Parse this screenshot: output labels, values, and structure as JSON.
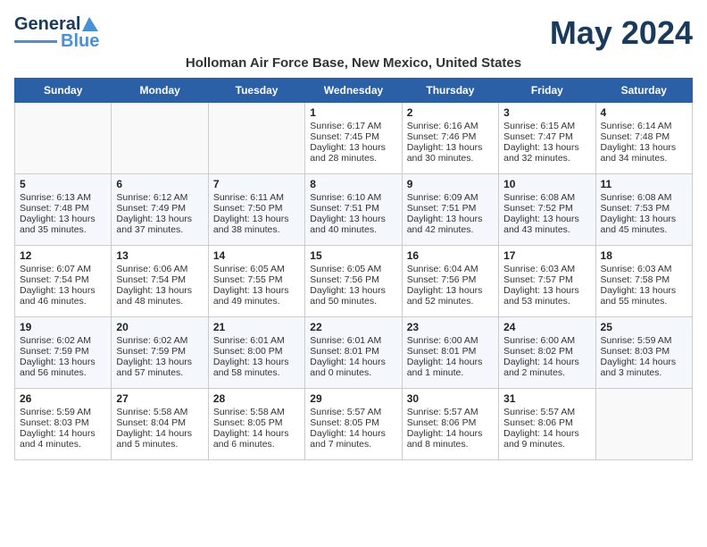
{
  "logo": {
    "line1": "General",
    "line2": "Blue"
  },
  "title": "May 2024",
  "subtitle": "Holloman Air Force Base, New Mexico, United States",
  "days_of_week": [
    "Sunday",
    "Monday",
    "Tuesday",
    "Wednesday",
    "Thursday",
    "Friday",
    "Saturday"
  ],
  "weeks": [
    [
      {
        "day": "",
        "sunrise": "",
        "sunset": "",
        "daylight": ""
      },
      {
        "day": "",
        "sunrise": "",
        "sunset": "",
        "daylight": ""
      },
      {
        "day": "",
        "sunrise": "",
        "sunset": "",
        "daylight": ""
      },
      {
        "day": "1",
        "sunrise": "Sunrise: 6:17 AM",
        "sunset": "Sunset: 7:45 PM",
        "daylight": "Daylight: 13 hours and 28 minutes."
      },
      {
        "day": "2",
        "sunrise": "Sunrise: 6:16 AM",
        "sunset": "Sunset: 7:46 PM",
        "daylight": "Daylight: 13 hours and 30 minutes."
      },
      {
        "day": "3",
        "sunrise": "Sunrise: 6:15 AM",
        "sunset": "Sunset: 7:47 PM",
        "daylight": "Daylight: 13 hours and 32 minutes."
      },
      {
        "day": "4",
        "sunrise": "Sunrise: 6:14 AM",
        "sunset": "Sunset: 7:48 PM",
        "daylight": "Daylight: 13 hours and 34 minutes."
      }
    ],
    [
      {
        "day": "5",
        "sunrise": "Sunrise: 6:13 AM",
        "sunset": "Sunset: 7:48 PM",
        "daylight": "Daylight: 13 hours and 35 minutes."
      },
      {
        "day": "6",
        "sunrise": "Sunrise: 6:12 AM",
        "sunset": "Sunset: 7:49 PM",
        "daylight": "Daylight: 13 hours and 37 minutes."
      },
      {
        "day": "7",
        "sunrise": "Sunrise: 6:11 AM",
        "sunset": "Sunset: 7:50 PM",
        "daylight": "Daylight: 13 hours and 38 minutes."
      },
      {
        "day": "8",
        "sunrise": "Sunrise: 6:10 AM",
        "sunset": "Sunset: 7:51 PM",
        "daylight": "Daylight: 13 hours and 40 minutes."
      },
      {
        "day": "9",
        "sunrise": "Sunrise: 6:09 AM",
        "sunset": "Sunset: 7:51 PM",
        "daylight": "Daylight: 13 hours and 42 minutes."
      },
      {
        "day": "10",
        "sunrise": "Sunrise: 6:08 AM",
        "sunset": "Sunset: 7:52 PM",
        "daylight": "Daylight: 13 hours and 43 minutes."
      },
      {
        "day": "11",
        "sunrise": "Sunrise: 6:08 AM",
        "sunset": "Sunset: 7:53 PM",
        "daylight": "Daylight: 13 hours and 45 minutes."
      }
    ],
    [
      {
        "day": "12",
        "sunrise": "Sunrise: 6:07 AM",
        "sunset": "Sunset: 7:54 PM",
        "daylight": "Daylight: 13 hours and 46 minutes."
      },
      {
        "day": "13",
        "sunrise": "Sunrise: 6:06 AM",
        "sunset": "Sunset: 7:54 PM",
        "daylight": "Daylight: 13 hours and 48 minutes."
      },
      {
        "day": "14",
        "sunrise": "Sunrise: 6:05 AM",
        "sunset": "Sunset: 7:55 PM",
        "daylight": "Daylight: 13 hours and 49 minutes."
      },
      {
        "day": "15",
        "sunrise": "Sunrise: 6:05 AM",
        "sunset": "Sunset: 7:56 PM",
        "daylight": "Daylight: 13 hours and 50 minutes."
      },
      {
        "day": "16",
        "sunrise": "Sunrise: 6:04 AM",
        "sunset": "Sunset: 7:56 PM",
        "daylight": "Daylight: 13 hours and 52 minutes."
      },
      {
        "day": "17",
        "sunrise": "Sunrise: 6:03 AM",
        "sunset": "Sunset: 7:57 PM",
        "daylight": "Daylight: 13 hours and 53 minutes."
      },
      {
        "day": "18",
        "sunrise": "Sunrise: 6:03 AM",
        "sunset": "Sunset: 7:58 PM",
        "daylight": "Daylight: 13 hours and 55 minutes."
      }
    ],
    [
      {
        "day": "19",
        "sunrise": "Sunrise: 6:02 AM",
        "sunset": "Sunset: 7:59 PM",
        "daylight": "Daylight: 13 hours and 56 minutes."
      },
      {
        "day": "20",
        "sunrise": "Sunrise: 6:02 AM",
        "sunset": "Sunset: 7:59 PM",
        "daylight": "Daylight: 13 hours and 57 minutes."
      },
      {
        "day": "21",
        "sunrise": "Sunrise: 6:01 AM",
        "sunset": "Sunset: 8:00 PM",
        "daylight": "Daylight: 13 hours and 58 minutes."
      },
      {
        "day": "22",
        "sunrise": "Sunrise: 6:01 AM",
        "sunset": "Sunset: 8:01 PM",
        "daylight": "Daylight: 14 hours and 0 minutes."
      },
      {
        "day": "23",
        "sunrise": "Sunrise: 6:00 AM",
        "sunset": "Sunset: 8:01 PM",
        "daylight": "Daylight: 14 hours and 1 minute."
      },
      {
        "day": "24",
        "sunrise": "Sunrise: 6:00 AM",
        "sunset": "Sunset: 8:02 PM",
        "daylight": "Daylight: 14 hours and 2 minutes."
      },
      {
        "day": "25",
        "sunrise": "Sunrise: 5:59 AM",
        "sunset": "Sunset: 8:03 PM",
        "daylight": "Daylight: 14 hours and 3 minutes."
      }
    ],
    [
      {
        "day": "26",
        "sunrise": "Sunrise: 5:59 AM",
        "sunset": "Sunset: 8:03 PM",
        "daylight": "Daylight: 14 hours and 4 minutes."
      },
      {
        "day": "27",
        "sunrise": "Sunrise: 5:58 AM",
        "sunset": "Sunset: 8:04 PM",
        "daylight": "Daylight: 14 hours and 5 minutes."
      },
      {
        "day": "28",
        "sunrise": "Sunrise: 5:58 AM",
        "sunset": "Sunset: 8:05 PM",
        "daylight": "Daylight: 14 hours and 6 minutes."
      },
      {
        "day": "29",
        "sunrise": "Sunrise: 5:57 AM",
        "sunset": "Sunset: 8:05 PM",
        "daylight": "Daylight: 14 hours and 7 minutes."
      },
      {
        "day": "30",
        "sunrise": "Sunrise: 5:57 AM",
        "sunset": "Sunset: 8:06 PM",
        "daylight": "Daylight: 14 hours and 8 minutes."
      },
      {
        "day": "31",
        "sunrise": "Sunrise: 5:57 AM",
        "sunset": "Sunset: 8:06 PM",
        "daylight": "Daylight: 14 hours and 9 minutes."
      },
      {
        "day": "",
        "sunrise": "",
        "sunset": "",
        "daylight": ""
      }
    ]
  ]
}
